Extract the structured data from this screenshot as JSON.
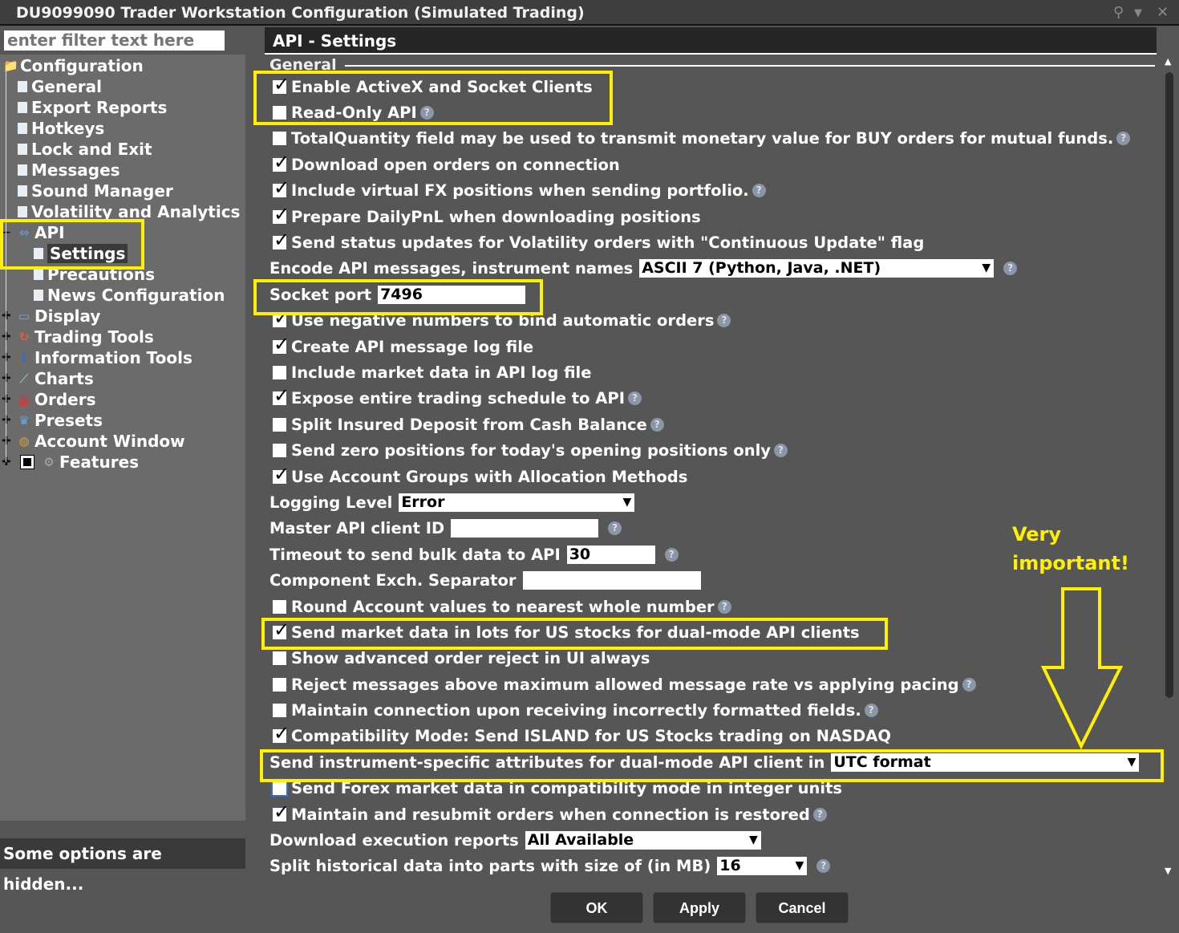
{
  "window": {
    "title": "DU9099090 Trader Workstation Configuration (Simulated Trading)"
  },
  "filter": {
    "placeholder": "enter filter text here"
  },
  "tree": [
    {
      "label": "Configuration",
      "icon": "folder-icon"
    },
    {
      "label": "General",
      "icon": "page-icon"
    },
    {
      "label": "Export Reports",
      "icon": "page-icon"
    },
    {
      "label": "Hotkeys",
      "icon": "page-icon"
    },
    {
      "label": "Lock and Exit",
      "icon": "page-icon"
    },
    {
      "label": "Messages",
      "icon": "page-icon"
    },
    {
      "label": "Sound Manager",
      "icon": "page-icon"
    },
    {
      "label": "Volatility and Analytics",
      "icon": "page-icon"
    },
    {
      "label": "API",
      "icon": "api-arrows-icon"
    },
    {
      "label": "Settings",
      "icon": "page-icon",
      "selected": true
    },
    {
      "label": "Precautions",
      "icon": "page-icon"
    },
    {
      "label": "News Configuration",
      "icon": "page-icon"
    },
    {
      "label": "Display",
      "icon": "display-icon"
    },
    {
      "label": "Trading Tools",
      "icon": "trading-tools-icon"
    },
    {
      "label": "Information Tools",
      "icon": "info-icon"
    },
    {
      "label": "Charts",
      "icon": "chart-icon"
    },
    {
      "label": "Orders",
      "icon": "orders-icon"
    },
    {
      "label": "Presets",
      "icon": "presets-icon"
    },
    {
      "label": "Account Window",
      "icon": "coins-icon"
    },
    {
      "label": "Features",
      "icon": "gear-icon"
    }
  ],
  "hidden_msg": "Some options are hidden...",
  "panel": {
    "title": "API - Settings",
    "section": "General"
  },
  "rows": [
    {
      "type": "cb",
      "label": "Enable ActiveX and Socket Clients",
      "checked": true
    },
    {
      "type": "cb",
      "label": "Read-Only API",
      "checked": false,
      "help": true
    },
    {
      "type": "cb",
      "label": "TotalQuantity field may be used to transmit monetary value for BUY orders for mutual funds.",
      "checked": false,
      "help": true
    },
    {
      "type": "cb",
      "label": "Download open orders on connection",
      "checked": true
    },
    {
      "type": "cb",
      "label": "Include virtual FX positions when sending portfolio.",
      "checked": true,
      "help": true
    },
    {
      "type": "cb",
      "label": "Prepare DailyPnL when downloading positions",
      "checked": true
    },
    {
      "type": "cb",
      "label": "Send status updates for Volatility orders with \"Continuous Update\" flag",
      "checked": true
    },
    {
      "type": "select",
      "label": "Encode API messages, instrument names",
      "value": "ASCII 7 (Python, Java, .NET)",
      "help": true
    },
    {
      "type": "input",
      "label": "Socket port",
      "value": "7496"
    },
    {
      "type": "cb",
      "label": "Use negative numbers to bind automatic orders",
      "checked": true,
      "help": true
    },
    {
      "type": "cb",
      "label": "Create API message log file",
      "checked": true
    },
    {
      "type": "cb",
      "label": "Include market data in API log file",
      "checked": false
    },
    {
      "type": "cb",
      "label": "Expose entire trading schedule to API",
      "checked": true,
      "help": true
    },
    {
      "type": "cb",
      "label": "Split Insured Deposit from Cash Balance",
      "checked": false,
      "help": true
    },
    {
      "type": "cb",
      "label": "Send zero positions for today's opening positions only",
      "checked": false,
      "help": true
    },
    {
      "type": "cb",
      "label": "Use Account Groups with Allocation Methods",
      "checked": true
    },
    {
      "type": "select",
      "label": "Logging Level",
      "value": "Error"
    },
    {
      "type": "input",
      "label": "Master API client ID",
      "value": "",
      "help": true
    },
    {
      "type": "input",
      "label": "Timeout to send bulk data to API",
      "value": "30",
      "help": true
    },
    {
      "type": "input",
      "label": "Component Exch. Separator",
      "value": ""
    },
    {
      "type": "cb",
      "label": "Round Account values to nearest whole number",
      "checked": false,
      "help": true
    },
    {
      "type": "cb",
      "label": "Send market data in lots for US stocks for dual-mode API clients",
      "checked": true
    },
    {
      "type": "cb",
      "label": "Show advanced order reject in UI always",
      "checked": false
    },
    {
      "type": "cb",
      "label": "Reject messages above maximum allowed message rate vs applying pacing",
      "checked": false,
      "help": true
    },
    {
      "type": "cb",
      "label": "Maintain connection upon receiving incorrectly formatted fields.",
      "checked": false,
      "help": true
    },
    {
      "type": "cb",
      "label": "Compatibility Mode: Send ISLAND for US Stocks trading on NASDAQ",
      "checked": true
    },
    {
      "type": "select",
      "label": "Send instrument-specific attributes for dual-mode API client in",
      "value": "UTC format"
    },
    {
      "type": "cb",
      "label": "Send Forex market data in compatibility mode in integer units",
      "checked": false,
      "focus": true
    },
    {
      "type": "cb",
      "label": "Maintain and resubmit orders when connection is restored",
      "checked": true,
      "help": true
    },
    {
      "type": "select",
      "label": "Download execution reports",
      "value": "All Available"
    },
    {
      "type": "select",
      "label": "Split historical data into parts with size of (in MB)",
      "value": "16",
      "help": true
    }
  ],
  "annotation": {
    "line1": "Very",
    "line2": "important!"
  },
  "buttons": {
    "ok": "OK",
    "apply": "Apply",
    "cancel": "Cancel"
  }
}
